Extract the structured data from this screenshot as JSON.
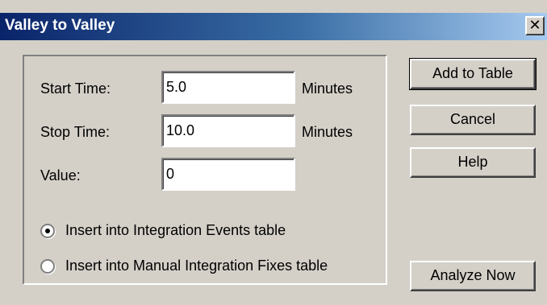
{
  "window": {
    "title": "Valley to Valley",
    "close_glyph": "✕"
  },
  "form": {
    "start_time": {
      "label": "Start Time:",
      "value": "5.0",
      "unit": "Minutes"
    },
    "stop_time": {
      "label": "Stop Time:",
      "value": "10.0",
      "unit": "Minutes"
    },
    "value": {
      "label": "Value:",
      "value": "0"
    },
    "options": [
      {
        "label": "Insert into Integration Events table",
        "selected": true
      },
      {
        "label": "Insert into Manual Integration Fixes table",
        "selected": false
      }
    ]
  },
  "buttons": {
    "add_to_table": "Add to Table",
    "cancel": "Cancel",
    "help": "Help",
    "analyze_now": "Analyze Now"
  },
  "colors": {
    "titlebar_start": "#0a246a",
    "titlebar_end": "#a6caf0",
    "dialog_face": "#d4d0c8"
  }
}
